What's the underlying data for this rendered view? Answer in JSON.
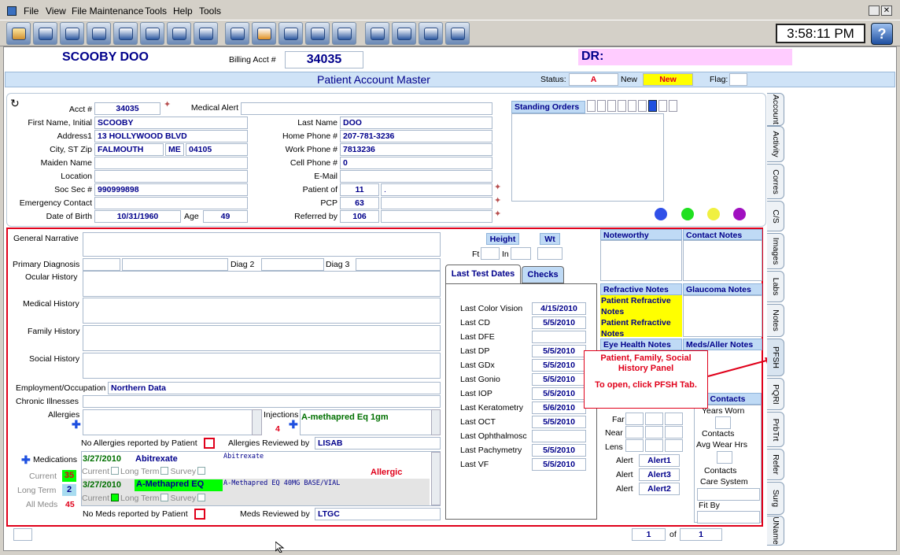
{
  "menu": [
    "File",
    "View",
    "File Maintenance",
    "Tools",
    "Help",
    "Tools"
  ],
  "clock": "3:58:11 PM",
  "patient": {
    "name": "SCOOBY DOO",
    "billing_label": "Billing Acct #",
    "billing_acct": "34035",
    "dr_label": "DR:"
  },
  "title": {
    "text": "Patient Account Master",
    "status_label": "Status:",
    "status_value": "A",
    "new_label": "New",
    "new_value": "New",
    "flag_label": "Flag:"
  },
  "labels": {
    "acct": "Acct #",
    "medical_alert": "Medical Alert",
    "first_name": "First Name, Initial",
    "last_name": "Last Name",
    "address1": "Address1",
    "home_phone": "Home Phone #",
    "city": "City, ST Zip",
    "work_phone": "Work Phone #",
    "maiden": "Maiden Name",
    "cell_phone": "Cell Phone #",
    "location": "Location",
    "email": "E-Mail",
    "ssn": "Soc Sec #",
    "patient_of": "Patient of",
    "emergency": "Emergency Contact",
    "pcp": "PCP",
    "dob": "Date of Birth",
    "age": "Age",
    "referred": "Referred by",
    "standing_orders": "Standing Orders"
  },
  "fields": {
    "acct": "34035",
    "first_name": "SCOOBY",
    "last_name": "DOO",
    "address1": "13 HOLLYWOOD BLVD",
    "home_phone": "207-781-3236",
    "city": "FALMOUTH",
    "state": "ME",
    "zip": "04105",
    "work_phone": "7813236",
    "cell_phone": "0",
    "ssn": "990999898",
    "patient_of": "11",
    "patient_of_dot": ".",
    "pcp": "63",
    "dob": "10/31/1960",
    "age": "49",
    "referred": "106"
  },
  "history": {
    "general": "General Narrative",
    "primary": "Primary Diagnosis",
    "diag2": "Diag 2",
    "diag3": "Diag 3",
    "ocular": "Ocular History",
    "medical": "Medical History",
    "family": "Family History",
    "social": "Social History",
    "employment": "Employment/Occupation",
    "employment_value": "Northern Data",
    "chronic": "Chronic Illnesses",
    "allergies": "Allergies",
    "injections": "Injections",
    "injections_count": "4",
    "injection_item": "A-methapred Eq 1gm",
    "no_allergies": "No Allergies reported by Patient",
    "allergies_reviewed": "Allergies Reviewed by",
    "allergies_reviewer": "LISAB"
  },
  "meds": {
    "label": "Medications",
    "current_label": "Current",
    "current_count": "35",
    "longterm_label": "Long Term",
    "longterm_count": "2",
    "all_label": "All Meds",
    "all_count": "45",
    "cb_current": "Current",
    "cb_longterm": "Long Term",
    "cb_survey": "Survey",
    "allergic": "Allergic",
    "no_meds": "No Meds reported by Patient",
    "meds_reviewed": "Meds Reviewed by",
    "meds_reviewer": "LTGC",
    "items": [
      {
        "date": "3/27/2010",
        "name": "Abitrexate",
        "detail": "Abitrexate"
      },
      {
        "date": "3/27/2010",
        "name": "A-Methapred EQ",
        "detail": "A-Methapred EQ 40MG BASE/VIAL"
      }
    ]
  },
  "vitals": {
    "height": "Height",
    "wt": "Wt",
    "ft": "Ft",
    "in": "In"
  },
  "tests": {
    "tab1": "Last Test Dates",
    "tab2": "Checks",
    "rows": [
      {
        "label": "Last Color Vision",
        "value": "4/15/2010"
      },
      {
        "label": "Last CD",
        "value": "5/5/2010"
      },
      {
        "label": "Last DFE",
        "value": ""
      },
      {
        "label": "Last DP",
        "value": "5/5/2010"
      },
      {
        "label": "Last GDx",
        "value": "5/5/2010"
      },
      {
        "label": "Last Gonio",
        "value": "5/5/2010"
      },
      {
        "label": "Last IOP",
        "value": "5/5/2010"
      },
      {
        "label": "Last Keratometry",
        "value": "5/6/2010"
      },
      {
        "label": "Last OCT",
        "value": "5/5/2010"
      },
      {
        "label": "Last Ophthalmosc",
        "value": ""
      },
      {
        "label": "Last Pachymetry",
        "value": "5/5/2010"
      },
      {
        "label": "Last VF",
        "value": "5/5/2010"
      }
    ]
  },
  "notes": {
    "noteworthy": "Noteworthy",
    "contact_notes": "Contact Notes",
    "refractive": "Refractive Notes",
    "glaucoma": "Glaucoma Notes",
    "patient_refractive_1": "Patient Refractive Notes",
    "patient_refractive_2": "Patient Refractive Notes",
    "eye_health": "Eye Health Notes",
    "meds_aller": "Meds/Aller Notes"
  },
  "callout": {
    "title": "Patient, Family, Social History Panel",
    "body": "To open, click PFSH Tab."
  },
  "contacts": {
    "header": "Contacts",
    "years_worn": "Years Worn",
    "contacts1": "Contacts",
    "avg_wear": "Avg Wear Hrs",
    "contacts2": "Contacts",
    "care_system": "Care System",
    "fit_by": "Fit By"
  },
  "visual": {
    "far": "Far",
    "near": "Near",
    "lens": "Lens",
    "alert": "Alert",
    "alerts": [
      "Alert1",
      "Alert3",
      "Alert2"
    ]
  },
  "pager": {
    "current": "1",
    "of": "of",
    "total": "1"
  },
  "tabs": [
    "Account",
    "Activity",
    "Corres",
    "C/S",
    "Images",
    "Labs",
    "Notes",
    "PFSH",
    "PQRI",
    "PrbTrt",
    "Refer",
    "Surg",
    "UName"
  ],
  "colors": {
    "accent": "#00008b",
    "alert_red": "#e0001a",
    "title_bar": "#cfe3f7",
    "dr_bg": "#ffccff",
    "new_bg": "#ffff00",
    "notes_yellow": "#ffff00",
    "meds_green": "#00ff00"
  }
}
